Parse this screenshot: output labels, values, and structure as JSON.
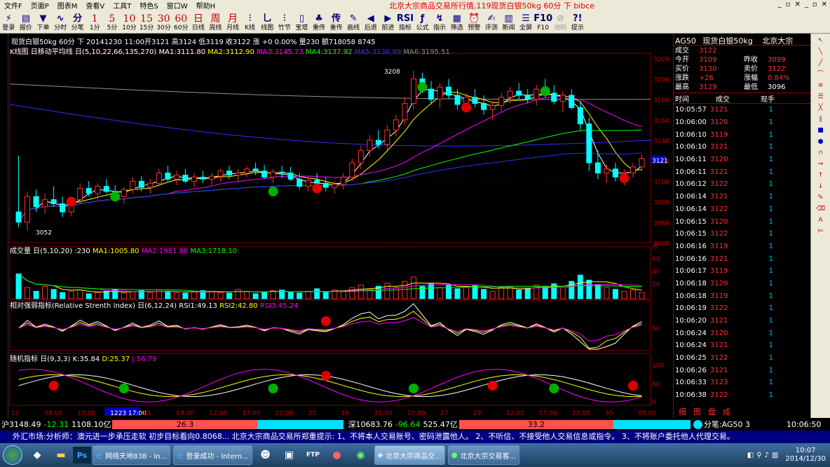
{
  "menu": {
    "items": [
      "文件F",
      "页面P",
      "图表M",
      "查看V",
      "工具T",
      "特色S",
      "窗口W",
      "帮助H"
    ],
    "title": "北京大宗商品交易所行情,119现货白银50kg 60分 下 bibce"
  },
  "toolbar": [
    {
      "icon": "⚡",
      "label": "登录"
    },
    {
      "icon": "▤",
      "label": "报价"
    },
    {
      "icon": "▼",
      "label": "下单"
    },
    {
      "icon": "∿",
      "label": "分时"
    },
    {
      "icon": "分",
      "label": "分笔"
    },
    {
      "icon": "1",
      "label": "1分"
    },
    {
      "icon": "5",
      "label": "5分"
    },
    {
      "icon": "10",
      "label": "10分"
    },
    {
      "icon": "15",
      "label": "15分"
    },
    {
      "icon": "30",
      "label": "30分"
    },
    {
      "icon": "60",
      "label": "60分"
    },
    {
      "icon": "日",
      "label": "日线"
    },
    {
      "icon": "周",
      "label": "周线"
    },
    {
      "icon": "月",
      "label": "月线"
    },
    {
      "icon": "⫶",
      "label": "K线"
    },
    {
      "icon": "⺃",
      "label": "线图"
    },
    {
      "icon": "⫶",
      "label": "竹节"
    },
    {
      "icon": "▯",
      "label": "宝塔"
    },
    {
      "icon": "♣",
      "label": "重传"
    },
    {
      "icon": "传",
      "label": "重传"
    },
    {
      "icon": "✎",
      "label": "画线"
    },
    {
      "icon": "◀",
      "label": "后退"
    },
    {
      "icon": "▶",
      "label": "前进"
    },
    {
      "icon": "RSI",
      "label": "指标"
    },
    {
      "icon": "ƒ",
      "label": "公式"
    },
    {
      "icon": "↯",
      "label": "指示"
    },
    {
      "icon": "▦",
      "label": "筛选"
    },
    {
      "icon": "⏰",
      "label": "预警"
    },
    {
      "icon": "✍",
      "label": "评测"
    },
    {
      "icon": "▥",
      "label": "新闻"
    },
    {
      "icon": "☰",
      "label": "全屏"
    },
    {
      "icon": "F10",
      "label": "F10"
    },
    {
      "icon": "⊘",
      "label": "池码"
    },
    {
      "icon": "?!",
      "label": "提示"
    }
  ],
  "chart_header": "现货白银50kg 60分 下 20141230 11:00开3121 高3124 低3119 收3122 涨 +0 0.00% 量230 额718058 8745",
  "ma_header": {
    "name": "K线图 日移动平均线 日(5,10,22,66,135,270)",
    "ma1": "MA1:3111.80",
    "ma2": "MA2:3112.90",
    "ma3": "MA3:3145.73",
    "ma4": "MA4:3137.92",
    "ma5": "MA5:3130.99",
    "ma6": "MA6:3195.51"
  },
  "vol_header": {
    "name": "成交量 日(5,10,20) :230",
    "ma1": "MA1:1005.80",
    "ma2": "MA2:1981.80",
    "ma3": "MA3:1718.10"
  },
  "rsi_header": {
    "name": "相对强弱指标(Relative Strenth Index) 日(6,12,24)",
    "r1": "RSI1:49.13",
    "r2": "RSI2:42.80",
    "r3": "RSI3:45.24"
  },
  "kdj_header": {
    "name": "随机指标 日(9,3,3)",
    "k": "K:35.84",
    "d": "D:25.37",
    "j": "J:56.79"
  },
  "price_axis": [
    "3220",
    "3200",
    "3180",
    "3160",
    "3140",
    "3120",
    "3100",
    "3080",
    "3060",
    "3040"
  ],
  "price_current": "3121",
  "annotations": {
    "high": "3208",
    "low": "3052"
  },
  "vol_axis": [
    "百",
    "60",
    "40",
    "20"
  ],
  "rsi_axis": [
    "50"
  ],
  "kdj_axis": [
    "100",
    "50",
    "0"
  ],
  "time_axis": [
    "12",
    "08:00",
    "13:00",
    "1223 17:00",
    "24",
    "04:00",
    "12:00",
    "17:00",
    "22:00",
    "25",
    "26",
    "15:00",
    "20:00",
    "27",
    "29",
    "12:00",
    "17:00",
    "22:00",
    "30",
    "09:00"
  ],
  "chart_data": {
    "type": "candlestick",
    "ylim": [
      3040,
      3225
    ],
    "ohlc": [
      [
        3070,
        3125,
        3055,
        3060
      ],
      [
        3060,
        3090,
        3052,
        3085
      ],
      [
        3085,
        3092,
        3070,
        3075
      ],
      [
        3075,
        3088,
        3068,
        3082
      ],
      [
        3082,
        3095,
        3075,
        3078
      ],
      [
        3078,
        3085,
        3065,
        3070
      ],
      [
        3070,
        3085,
        3066,
        3082
      ],
      [
        3082,
        3098,
        3078,
        3093
      ],
      [
        3093,
        3100,
        3085,
        3088
      ],
      [
        3088,
        3098,
        3082,
        3095
      ],
      [
        3095,
        3102,
        3088,
        3090
      ],
      [
        3090,
        3096,
        3080,
        3085
      ],
      [
        3085,
        3094,
        3078,
        3092
      ],
      [
        3092,
        3104,
        3088,
        3100
      ],
      [
        3100,
        3105,
        3090,
        3094
      ],
      [
        3094,
        3102,
        3088,
        3098
      ],
      [
        3098,
        3112,
        3095,
        3108
      ],
      [
        3108,
        3115,
        3100,
        3102
      ],
      [
        3102,
        3110,
        3096,
        3106
      ],
      [
        3106,
        3112,
        3098,
        3100
      ],
      [
        3100,
        3108,
        3094,
        3104
      ],
      [
        3104,
        3110,
        3098,
        3102
      ],
      [
        3102,
        3108,
        3096,
        3105
      ],
      [
        3105,
        3112,
        3100,
        3110
      ],
      [
        3110,
        3115,
        3102,
        3106
      ],
      [
        3106,
        3112,
        3100,
        3108
      ],
      [
        3108,
        3115,
        3104,
        3112
      ],
      [
        3112,
        3118,
        3106,
        3110
      ],
      [
        3110,
        3116,
        3102,
        3104
      ],
      [
        3104,
        3112,
        3098,
        3109
      ],
      [
        3109,
        3115,
        3103,
        3108
      ],
      [
        3108,
        3114,
        3100,
        3102
      ],
      [
        3102,
        3108,
        3092,
        3095
      ],
      [
        3095,
        3104,
        3090,
        3101
      ],
      [
        3101,
        3108,
        3094,
        3098
      ],
      [
        3098,
        3104,
        3090,
        3094
      ],
      [
        3094,
        3100,
        3088,
        3097
      ],
      [
        3097,
        3108,
        3092,
        3104
      ],
      [
        3104,
        3122,
        3100,
        3118
      ],
      [
        3118,
        3135,
        3112,
        3130
      ],
      [
        3130,
        3145,
        3124,
        3140
      ],
      [
        3140,
        3150,
        3132,
        3136
      ],
      [
        3136,
        3155,
        3130,
        3150
      ],
      [
        3150,
        3165,
        3144,
        3160
      ],
      [
        3160,
        3182,
        3155,
        3176
      ],
      [
        3176,
        3208,
        3170,
        3200
      ],
      [
        3200,
        3206,
        3186,
        3190
      ],
      [
        3190,
        3198,
        3175,
        3180
      ],
      [
        3180,
        3196,
        3172,
        3192
      ],
      [
        3192,
        3200,
        3180,
        3184
      ],
      [
        3184,
        3190,
        3170,
        3175
      ],
      [
        3175,
        3186,
        3168,
        3182
      ],
      [
        3182,
        3190,
        3172,
        3176
      ],
      [
        3176,
        3184,
        3165,
        3170
      ],
      [
        3170,
        3178,
        3160,
        3174
      ],
      [
        3174,
        3186,
        3168,
        3182
      ],
      [
        3182,
        3192,
        3176,
        3188
      ],
      [
        3188,
        3196,
        3180,
        3184
      ],
      [
        3184,
        3190,
        3176,
        3180
      ],
      [
        3180,
        3194,
        3174,
        3190
      ],
      [
        3190,
        3200,
        3182,
        3186
      ],
      [
        3186,
        3194,
        3175,
        3178
      ],
      [
        3178,
        3188,
        3168,
        3184
      ],
      [
        3184,
        3190,
        3170,
        3172
      ],
      [
        3172,
        3178,
        3150,
        3156
      ],
      [
        3156,
        3162,
        3110,
        3118
      ],
      [
        3118,
        3130,
        3102,
        3108
      ],
      [
        3108,
        3116,
        3098,
        3112
      ],
      [
        3112,
        3118,
        3100,
        3104
      ],
      [
        3104,
        3112,
        3096,
        3108
      ],
      [
        3108,
        3118,
        3104,
        3114
      ],
      [
        3114,
        3126,
        3110,
        3122
      ]
    ],
    "volume": [
      40,
      18,
      12,
      20,
      15,
      10,
      12,
      14,
      8,
      10,
      12,
      15,
      9,
      11,
      13,
      10,
      14,
      12,
      10,
      9,
      11,
      13,
      12,
      10,
      9,
      15,
      12,
      8,
      11,
      13,
      14,
      10,
      9,
      12,
      16,
      10,
      14,
      12,
      18,
      22,
      15,
      20,
      25,
      18,
      28,
      35,
      20,
      24,
      18,
      22,
      16,
      19,
      21,
      15,
      12,
      18,
      20,
      14,
      17,
      22,
      19,
      24,
      18,
      28,
      38,
      30,
      22,
      18,
      15,
      12,
      14,
      10
    ]
  },
  "right_panel": {
    "code": "AG50",
    "name": "现货白银50kg",
    "exchange": "北京大宗",
    "quote": [
      {
        "k": "成交",
        "v": "3122"
      },
      {
        "k": "今开",
        "v": "3109"
      },
      {
        "k": "昨收",
        "v": "3099"
      },
      {
        "k": "买价",
        "v": "3130"
      },
      {
        "k": "卖价",
        "v": "3122"
      },
      {
        "k": "涨跌",
        "v": "+26"
      },
      {
        "k": "涨幅",
        "v": "0.84%"
      },
      {
        "k": "最高",
        "v": "3129"
      },
      {
        "k": "最低",
        "v": "3096"
      }
    ],
    "tick_head": [
      "时间",
      "成交",
      "现手"
    ],
    "ticks": [
      [
        "10:05:57",
        "3121",
        "1"
      ],
      [
        "10:06:00",
        "3120",
        "1"
      ],
      [
        "10:06:10",
        "3119",
        "1"
      ],
      [
        "10:06:10",
        "3121",
        "1"
      ],
      [
        "10:06:11",
        "3120",
        "1"
      ],
      [
        "10:06:11",
        "3121",
        "1"
      ],
      [
        "10:06:12",
        "3122",
        "1"
      ],
      [
        "10:06:14",
        "3121",
        "1"
      ],
      [
        "10:06:14",
        "3122",
        "1"
      ],
      [
        "10:06:15",
        "3120",
        "1"
      ],
      [
        "10:06:15",
        "3122",
        "1"
      ],
      [
        "10:06:16",
        "3119",
        "1"
      ],
      [
        "10:06:16",
        "3121",
        "1"
      ],
      [
        "10:06:17",
        "3119",
        "1"
      ],
      [
        "10:06:18",
        "3120",
        "1"
      ],
      [
        "10:06:18",
        "3119",
        "1"
      ],
      [
        "10:06:19",
        "3122",
        "1"
      ],
      [
        "10:06:20",
        "3121",
        "1"
      ],
      [
        "10:06:24",
        "3120",
        "1"
      ],
      [
        "10:06:24",
        "3121",
        "1"
      ],
      [
        "10:06:25",
        "3122",
        "1"
      ],
      [
        "10:06:26",
        "3121",
        "1"
      ],
      [
        "10:06:33",
        "3123",
        "1"
      ],
      [
        "10:06:38",
        "3122",
        "1"
      ]
    ],
    "tabs": [
      "细",
      "图",
      "盘",
      "成"
    ]
  },
  "status": {
    "sh": "沪3148.49",
    "sh_ch": "-12.31",
    "sh_amt": "1108.10亿",
    "sh_bar": "26.3",
    "sz": "深10683.76",
    "sz_ch": "-96.64",
    "sz_amt": "525.47亿",
    "sz_bar": "33.2",
    "alert": "分笔:AG50 3",
    "time": "10:06:50"
  },
  "marquee": "外汇市场:分析师：澳元进一步承压走软 初步目标看向0.8068...    北京大宗商品交易所郑重提示:    1、不将本人交易账号、密码泄露他人。    2、不听信、不接受他人交易信息或指令。    3、不将账户委托他人代理交易。",
  "taskbar": {
    "buttons": [
      "网络天地838 - In...",
      "登录成功 - Intern...",
      "北京大宗商品交...",
      "北京大宗交易客..."
    ],
    "date": "2014/12/30",
    "clock": "10:07"
  }
}
